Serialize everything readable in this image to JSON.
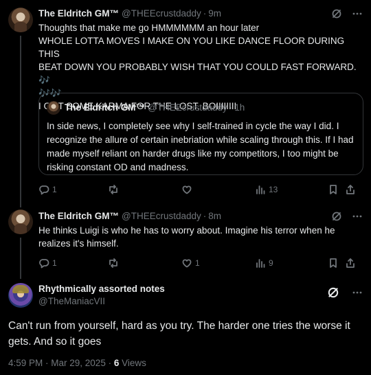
{
  "tweets": [
    {
      "name": "The Eldritch GM™",
      "handle": "@THEEcrustdaddy",
      "time": "9m",
      "lines": [
        "Thoughts that make me go HMMMMMM an hour later",
        "WHOLE LOTTA MOVES I MAKE ON YOU LIKE DANCE FLOOR DURING THIS",
        "BEAT DOWN YOU PROBABLY WISH THAT YOU COULD FAST FORWARD.",
        "I GOT SOME KARMA FOR THE LOST, BOIIIIIIII"
      ],
      "emoji_inline": "🎶",
      "emoji_line": "🎶🎶",
      "quote": {
        "name": "The Eldritch GM™",
        "handle": "@THEEcrustdaddy",
        "time": "1h",
        "text": "In side news, I completely see why I self-trained in cycle the way I did. I recognize the allure of certain inebriation while scaling through this. If I had made myself reliant on harder drugs like my competitors, I too might be risking constant OD and madness."
      },
      "actions": {
        "replies": "1",
        "reposts": "",
        "likes": "",
        "views": "13"
      }
    },
    {
      "name": "The Eldritch GM™",
      "handle": "@THEEcrustdaddy",
      "time": "8m",
      "lines": [
        "He thinks Luigi is who he has to worry about. Imagine his terror when he",
        "realizes it's himself."
      ],
      "actions": {
        "replies": "1",
        "reposts": "",
        "likes": "1",
        "views": "9"
      }
    }
  ],
  "main_tweet": {
    "name": "Rhythmically assorted notes",
    "handle": "@TheManiacVII",
    "text_line1": "Can't run from yourself, hard as you try. The harder one tries the worse it",
    "text_line2": "gets. And so it goes",
    "timestamp": "4:59 PM · Mar 29, 2025 · ",
    "views_count": "6",
    "views_label": " Views"
  },
  "icons": {
    "grok": "grok-icon",
    "more": "more-icon",
    "reply": "reply-icon",
    "repost": "repost-icon",
    "like": "like-icon",
    "views": "views-icon",
    "bookmark": "bookmark-icon",
    "share": "share-icon"
  },
  "colors": {
    "background": "#000000",
    "text": "#e7e9ea",
    "muted": "#71767b",
    "border": "#333639",
    "accent": "#1d9bf0"
  }
}
